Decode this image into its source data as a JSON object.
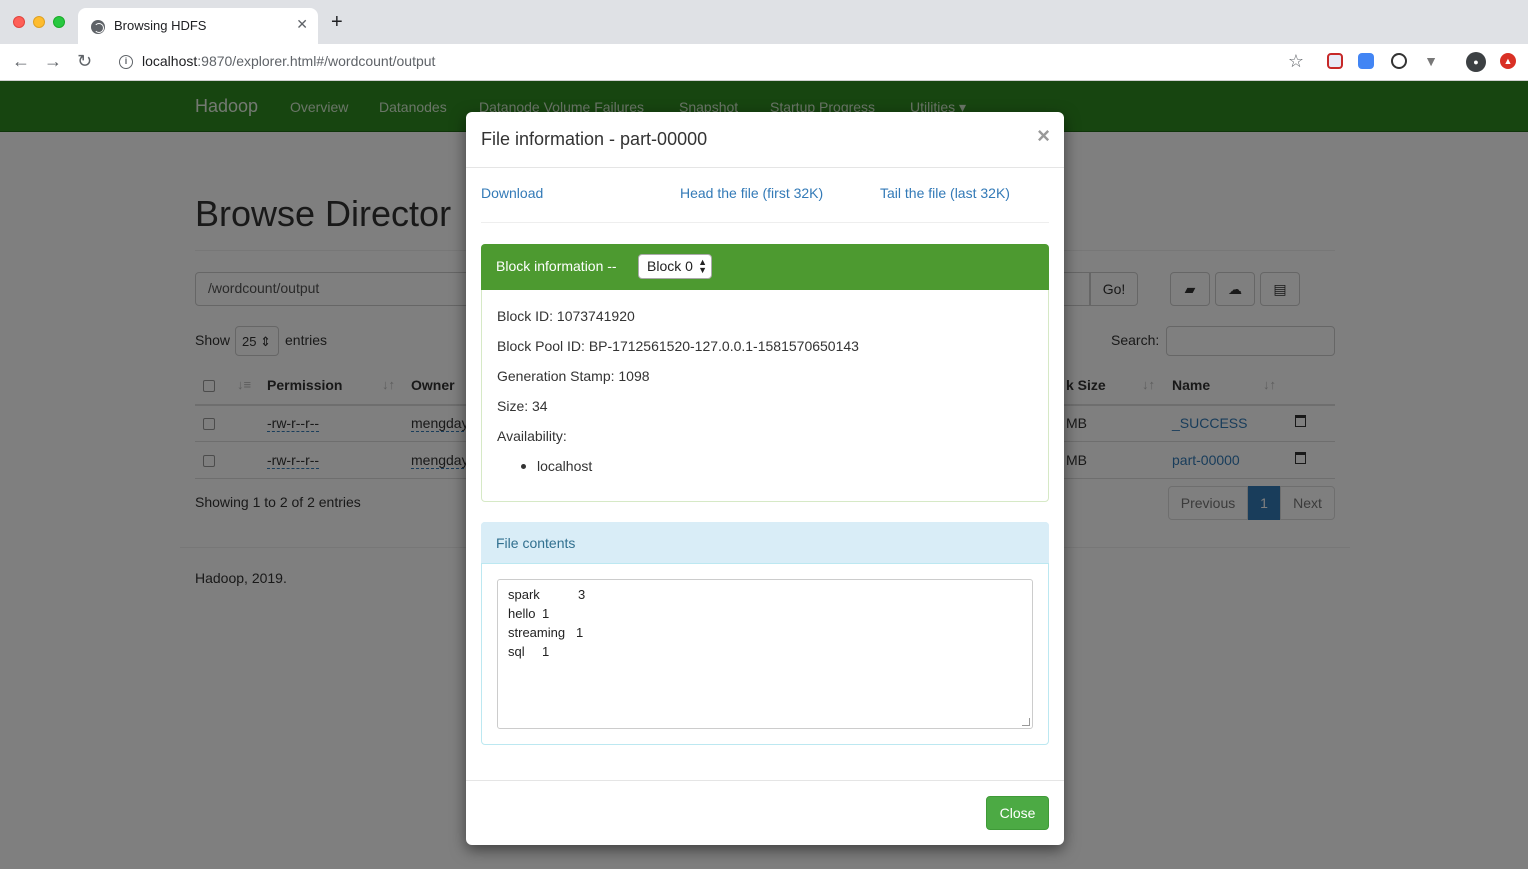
{
  "browser": {
    "tab_title": "Browsing HDFS",
    "url_host": "localhost",
    "url_path": ":9870/explorer.html#/wordcount/output"
  },
  "navbar": {
    "brand": "Hadoop",
    "links": [
      "Overview",
      "Datanodes",
      "Datanode Volume Failures",
      "Snapshot",
      "Startup Progress",
      "Utilities ▾"
    ]
  },
  "browse": {
    "title": "Browse Director",
    "path_value": "/wordcount/output",
    "go_label": "Go!",
    "show_label": "Show",
    "entries_value": "25",
    "entries_label": "entries",
    "search_label": "Search:",
    "columns": [
      "Permission",
      "Owner",
      "k Size",
      "Name"
    ],
    "rows": [
      {
        "permission": "-rw-r--r--",
        "owner": "mengday",
        "block_size": "MB",
        "name": "_SUCCESS"
      },
      {
        "permission": "-rw-r--r--",
        "owner": "mengday",
        "block_size": "MB",
        "name": "part-00000"
      }
    ],
    "showing": "Showing 1 to 2 of 2 entries",
    "pagination": {
      "previous": "Previous",
      "current": "1",
      "next": "Next"
    },
    "footer": "Hadoop, 2019."
  },
  "modal": {
    "title": "File information - part-00000",
    "close_x": "×",
    "links": {
      "download": "Download",
      "head": "Head the file (first 32K)",
      "tail": "Tail the file (last 32K)"
    },
    "block_panel": {
      "title": "Block information --",
      "block_select": "Block 0",
      "block_id": "Block ID: 1073741920",
      "block_pool_id": "Block Pool ID: BP-1712561520-127.0.0.1-1581570650143",
      "generation_stamp": "Generation Stamp: 1098",
      "size": "Size: 34",
      "availability": "Availability:",
      "hosts": [
        "localhost"
      ]
    },
    "contents_panel": {
      "title": "File contents",
      "lines": [
        {
          "word": "spark",
          "count": "3"
        },
        {
          "word": "hello",
          "count": "1"
        },
        {
          "word": "streaming",
          "count": "1"
        },
        {
          "word": "sql",
          "count": "1"
        }
      ]
    },
    "close_label": "Close"
  }
}
